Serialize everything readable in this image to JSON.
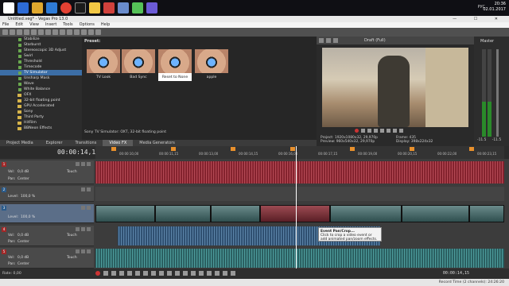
{
  "taskbar": {
    "time": "20:36",
    "date": "02.01.2017",
    "lang": "РУС"
  },
  "window": {
    "title": "Untitled.veg* - Vegas Pro 13.0",
    "controls": "—  ☐  ✕"
  },
  "menu": [
    "File",
    "Edit",
    "View",
    "Insert",
    "Tools",
    "Options",
    "Help"
  ],
  "fx_list": [
    {
      "label": "Stabilize",
      "kind": "plug"
    },
    {
      "label": "Starburst",
      "kind": "plug"
    },
    {
      "label": "Stereoscopic 3D Adjust",
      "kind": "plug"
    },
    {
      "label": "Swirl",
      "kind": "plug"
    },
    {
      "label": "Threshold",
      "kind": "plug"
    },
    {
      "label": "Timecode",
      "kind": "plug"
    },
    {
      "label": "TV Simulator",
      "kind": "plug",
      "selected": true
    },
    {
      "label": "Unsharp Mask",
      "kind": "plug"
    },
    {
      "label": "Wave",
      "kind": "plug"
    },
    {
      "label": "White Balance",
      "kind": "plug"
    },
    {
      "label": "OFX",
      "kind": "folder"
    },
    {
      "label": "32-bit floating point",
      "kind": "folder"
    },
    {
      "label": "GPU Accelerated",
      "kind": "folder"
    },
    {
      "label": "Sony",
      "kind": "folder"
    },
    {
      "label": "Third Party",
      "kind": "folder"
    },
    {
      "label": "HitFilm",
      "kind": "folder"
    },
    {
      "label": "BBNeon Effects",
      "kind": "folder"
    }
  ],
  "preset": {
    "label": "Preset:",
    "thumbs": [
      {
        "label": "TV Look"
      },
      {
        "label": "Bad Sync"
      },
      {
        "label": "Reset to None",
        "selected": true
      },
      {
        "label": "apple"
      }
    ],
    "description": "Sony TV Simulator: OXT, 32-bit floating point"
  },
  "left_tabs": [
    "Project Media",
    "Explorer",
    "Transitions",
    "Video FX",
    "Media Generators"
  ],
  "left_tabs_active": 3,
  "preview": {
    "quality": "Draft (Full)",
    "project": "Project:  1920x1080x32, 29,970p",
    "preview_res": "Preview:  960x540x32, 29,970p",
    "frame": "Frame:  435",
    "display": "Display:  398x224x32"
  },
  "master": {
    "label": "Master",
    "left_db": "-11.5",
    "right_db": "-11.5"
  },
  "timeline": {
    "timecode": "00:00:14,15",
    "ruler_ticks": [
      "00:00:10,00",
      "00:00:11,15",
      "00:00:13,00",
      "00:00:14,15",
      "00:00:16,00",
      "00:00:17,15",
      "00:00:19,00",
      "00:00:20,15",
      "00:00:22,00",
      "00:00:23,15"
    ],
    "marker_count": 7
  },
  "tracks": [
    {
      "num": "1",
      "type": "audio",
      "vol_label": "Vol:",
      "vol": "0,0 dB",
      "pan_label": "Pan:",
      "pan": "Center",
      "mode": "Touch"
    },
    {
      "num": "2",
      "type": "video",
      "level_label": "Level:",
      "level": "100,0 %"
    },
    {
      "num": "3",
      "type": "video",
      "level_label": "Level:",
      "level": "100,0 %"
    },
    {
      "num": "4",
      "type": "audio",
      "vol_label": "Vol:",
      "vol": "0,0 dB",
      "pan_label": "Pan:",
      "pan": "Center",
      "mode": "Touch"
    },
    {
      "num": "5",
      "type": "audio",
      "vol_label": "Vol:",
      "vol": "0,0 dB",
      "pan_label": "Pan:",
      "pan": "Center",
      "mode": "Touch"
    }
  ],
  "tooltip": {
    "title": "Event Pan/Crop...",
    "text": "Click to crop a video event or add animated pan/zoom effects."
  },
  "transport": {
    "rate": "Rate: 0,00",
    "time": "00:00:14,15"
  },
  "status": {
    "text": "Record Time (2 channels): 24:26:20"
  }
}
